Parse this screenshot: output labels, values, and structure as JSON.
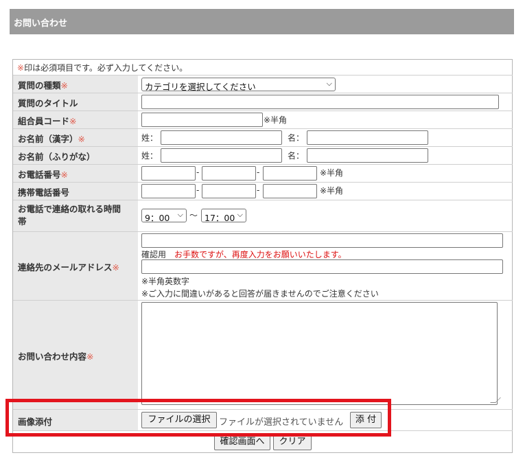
{
  "header": {
    "title": "お問い合わせ"
  },
  "notice": {
    "mark": "※",
    "text": "印は必須項目です。必ず入力してください。"
  },
  "req_mark": "※",
  "fields": {
    "question_type": {
      "label": "質問の種類",
      "value": "カテゴリを選択してください"
    },
    "question_title": {
      "label": "質問のタイトル"
    },
    "member_code": {
      "label": "組合員コード",
      "note": "※半角"
    },
    "name_kanji": {
      "label": "お名前（漢字）",
      "sei": "姓：",
      "mei": "名："
    },
    "name_kana": {
      "label": "お名前（ふりがな）",
      "sei": "姓：",
      "mei": "名："
    },
    "phone": {
      "label": "お電話番号",
      "sep": "-",
      "note": "※半角"
    },
    "mobile": {
      "label": "携帯電話番号",
      "sep": "-",
      "note": "※半角"
    },
    "contact_time": {
      "label_line1": "お電話で連絡の取れる時間",
      "label_line2": "帯",
      "from": "9：00",
      "tilde": "～",
      "to": "17：00"
    },
    "email": {
      "label": "連絡先のメールアドレス",
      "confirm_label": "確認用",
      "confirm_note": "お手数ですが、再度入力をお願いいたします。",
      "note1": "※半角英数字",
      "note2": "※ご入力に間違いがあると回答が届きませんのでご注意ください"
    },
    "inquiry": {
      "label": "お問い合わせ内容"
    },
    "image": {
      "label": "画像添付",
      "choose_button": "ファイルの選択",
      "no_file": "ファイルが選択されていません",
      "attach_button": "添 付"
    }
  },
  "actions": {
    "confirm": "確認画面へ",
    "clear": "クリア"
  }
}
